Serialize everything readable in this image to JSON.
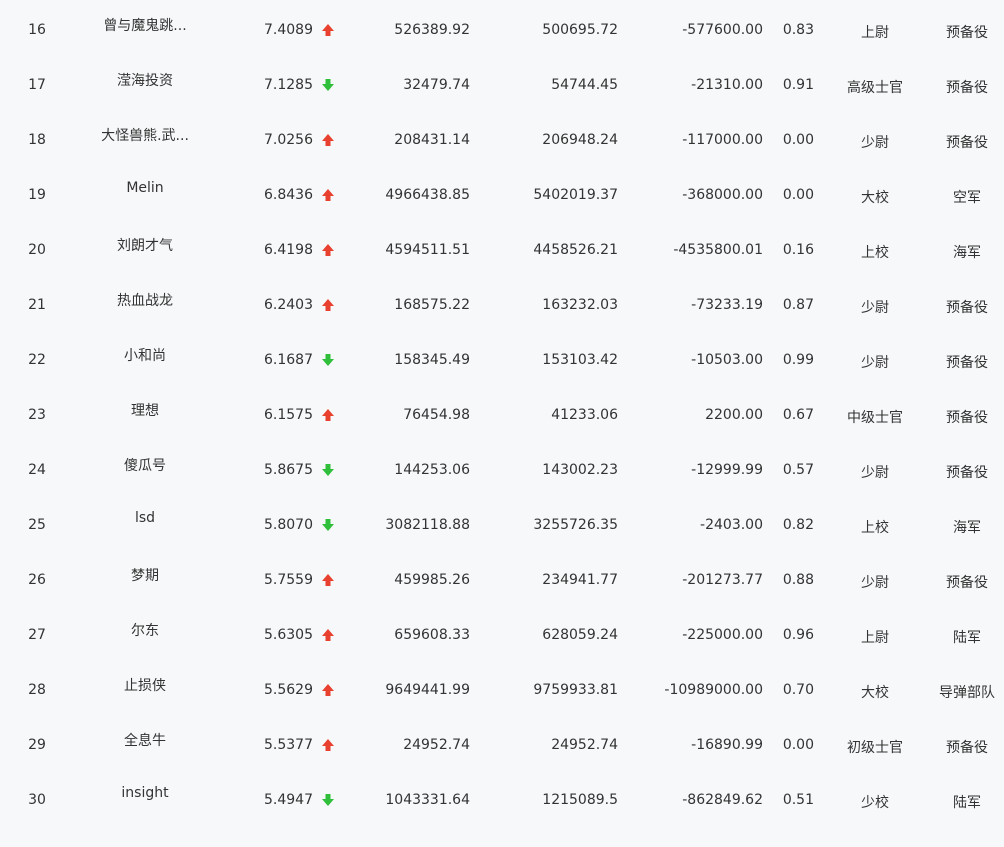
{
  "colors": {
    "up": "#e8412f",
    "down": "#2fbf3a",
    "text": "#333333",
    "background": "#f7f8fa"
  },
  "rows": [
    {
      "rank": "16",
      "name": "曾与魔鬼跳...",
      "score": "7.4089",
      "trend": "up",
      "v1": "526389.92",
      "v2": "500695.72",
      "v3": "-577600.00",
      "ratio": "0.83",
      "military_rank": "上尉",
      "branch": "预备役"
    },
    {
      "rank": "17",
      "name": "滢海投资",
      "score": "7.1285",
      "trend": "down",
      "v1": "32479.74",
      "v2": "54744.45",
      "v3": "-21310.00",
      "ratio": "0.91",
      "military_rank": "高级士官",
      "branch": "预备役"
    },
    {
      "rank": "18",
      "name": "大怪兽熊.武...",
      "score": "7.0256",
      "trend": "up",
      "v1": "208431.14",
      "v2": "206948.24",
      "v3": "-117000.00",
      "ratio": "0.00",
      "military_rank": "少尉",
      "branch": "预备役"
    },
    {
      "rank": "19",
      "name": "Melin",
      "score": "6.8436",
      "trend": "up",
      "v1": "4966438.85",
      "v2": "5402019.37",
      "v3": "-368000.00",
      "ratio": "0.00",
      "military_rank": "大校",
      "branch": "空军"
    },
    {
      "rank": "20",
      "name": "刘朗才气",
      "score": "6.4198",
      "trend": "up",
      "v1": "4594511.51",
      "v2": "4458526.21",
      "v3": "-4535800.01",
      "ratio": "0.16",
      "military_rank": "上校",
      "branch": "海军"
    },
    {
      "rank": "21",
      "name": "热血战龙",
      "score": "6.2403",
      "trend": "up",
      "v1": "168575.22",
      "v2": "163232.03",
      "v3": "-73233.19",
      "ratio": "0.87",
      "military_rank": "少尉",
      "branch": "预备役"
    },
    {
      "rank": "22",
      "name": "小和尚",
      "score": "6.1687",
      "trend": "down",
      "v1": "158345.49",
      "v2": "153103.42",
      "v3": "-10503.00",
      "ratio": "0.99",
      "military_rank": "少尉",
      "branch": "预备役"
    },
    {
      "rank": "23",
      "name": "理想",
      "score": "6.1575",
      "trend": "up",
      "v1": "76454.98",
      "v2": "41233.06",
      "v3": "2200.00",
      "ratio": "0.67",
      "military_rank": "中级士官",
      "branch": "预备役"
    },
    {
      "rank": "24",
      "name": "傻瓜号",
      "score": "5.8675",
      "trend": "down",
      "v1": "144253.06",
      "v2": "143002.23",
      "v3": "-12999.99",
      "ratio": "0.57",
      "military_rank": "少尉",
      "branch": "预备役"
    },
    {
      "rank": "25",
      "name": "lsd",
      "score": "5.8070",
      "trend": "down",
      "v1": "3082118.88",
      "v2": "3255726.35",
      "v3": "-2403.00",
      "ratio": "0.82",
      "military_rank": "上校",
      "branch": "海军"
    },
    {
      "rank": "26",
      "name": "梦期",
      "score": "5.7559",
      "trend": "up",
      "v1": "459985.26",
      "v2": "234941.77",
      "v3": "-201273.77",
      "ratio": "0.88",
      "military_rank": "少尉",
      "branch": "预备役"
    },
    {
      "rank": "27",
      "name": "尔东",
      "score": "5.6305",
      "trend": "up",
      "v1": "659608.33",
      "v2": "628059.24",
      "v3": "-225000.00",
      "ratio": "0.96",
      "military_rank": "上尉",
      "branch": "陆军"
    },
    {
      "rank": "28",
      "name": "止损侠",
      "score": "5.5629",
      "trend": "up",
      "v1": "9649441.99",
      "v2": "9759933.81",
      "v3": "-10989000.00",
      "ratio": "0.70",
      "military_rank": "大校",
      "branch": "导弹部队"
    },
    {
      "rank": "29",
      "name": "全息牛",
      "score": "5.5377",
      "trend": "up",
      "v1": "24952.74",
      "v2": "24952.74",
      "v3": "-16890.99",
      "ratio": "0.00",
      "military_rank": "初级士官",
      "branch": "预备役"
    },
    {
      "rank": "30",
      "name": "insight",
      "score": "5.4947",
      "trend": "down",
      "v1": "1043331.64",
      "v2": "1215089.5",
      "v3": "-862849.62",
      "ratio": "0.51",
      "military_rank": "少校",
      "branch": "陆军"
    }
  ]
}
